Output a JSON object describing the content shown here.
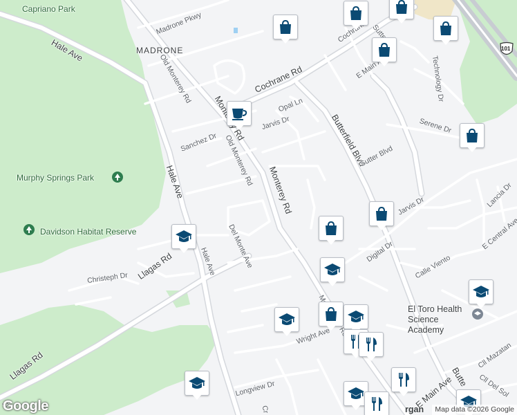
{
  "map": {
    "colors": {
      "background": "#f3f4f6",
      "park": "#cdeccb",
      "road": "#ffffff",
      "road_edge": "#d5d8dd",
      "highway": "#c8ccd2",
      "marker": "#0b4a73",
      "park_pin": "#2e7d4f"
    },
    "area_label": "MADRONE",
    "parks": [
      "Capriano Park",
      "Murphy Springs Park",
      "Davidson Habitat Reserve"
    ],
    "streets": [
      "Madrone Pkwy",
      "Hale Ave",
      "Cochrane Rd",
      "Old Monterey Rd",
      "Monterey Rd",
      "Opal Ln",
      "Jarvis Dr",
      "Sanchez Dr",
      "Old Monterey Rd",
      "Butterfield Blvd",
      "Sutter Blvd",
      "Serene Dr",
      "Technology Dr",
      "Jarvis Dr",
      "Sutter Blvd",
      "Hale Ave",
      "Del Monte Ave",
      "Llagas Rd",
      "Hale Ave",
      "Christeph Dr",
      "Digital Dr",
      "Jarvis Dr",
      "Lancia Dr",
      "E Central Ave",
      "Calle Viento",
      "Wright Ave",
      "Llagas Rd",
      "Longview Dr",
      "E Main Ave",
      "Cll Mazatan",
      "Cll Del Sol",
      "Butte",
      "Jarvis",
      "Mo",
      "Ro",
      "Cochrane",
      "Sutter",
      "Rd",
      "Ln",
      "rgan",
      "Cr"
    ],
    "place": {
      "name": "El Toro Health Science Academy"
    },
    "highway_shield": "101",
    "markers": [
      {
        "type": "shopping",
        "icon": "shopping-bag-icon"
      },
      {
        "type": "shopping",
        "icon": "shopping-bag-icon"
      },
      {
        "type": "shopping",
        "icon": "shopping-bag-icon"
      },
      {
        "type": "shopping",
        "icon": "shopping-bag-icon"
      },
      {
        "type": "shopping",
        "icon": "shopping-bag-icon"
      },
      {
        "type": "shopping",
        "icon": "shopping-bag-icon"
      },
      {
        "type": "shopping",
        "icon": "shopping-bag-icon"
      },
      {
        "type": "shopping",
        "icon": "shopping-bag-icon"
      },
      {
        "type": "shopping",
        "icon": "shopping-bag-icon"
      },
      {
        "type": "cafe",
        "icon": "coffee-cup-icon"
      },
      {
        "type": "school",
        "icon": "graduation-cap-icon"
      },
      {
        "type": "school",
        "icon": "graduation-cap-icon"
      },
      {
        "type": "school",
        "icon": "graduation-cap-icon"
      },
      {
        "type": "school",
        "icon": "graduation-cap-icon"
      },
      {
        "type": "school",
        "icon": "graduation-cap-icon"
      },
      {
        "type": "school",
        "icon": "graduation-cap-icon"
      },
      {
        "type": "school",
        "icon": "graduation-cap-icon"
      },
      {
        "type": "school",
        "icon": "graduation-cap-icon"
      },
      {
        "type": "restaurant",
        "icon": "fork-knife-icon"
      },
      {
        "type": "restaurant",
        "icon": "fork-knife-icon"
      },
      {
        "type": "restaurant",
        "icon": "fork-knife-icon"
      },
      {
        "type": "restaurant",
        "icon": "fork-knife-icon"
      }
    ],
    "logo": "Google",
    "attribution": "Map data ©2026 Google"
  }
}
